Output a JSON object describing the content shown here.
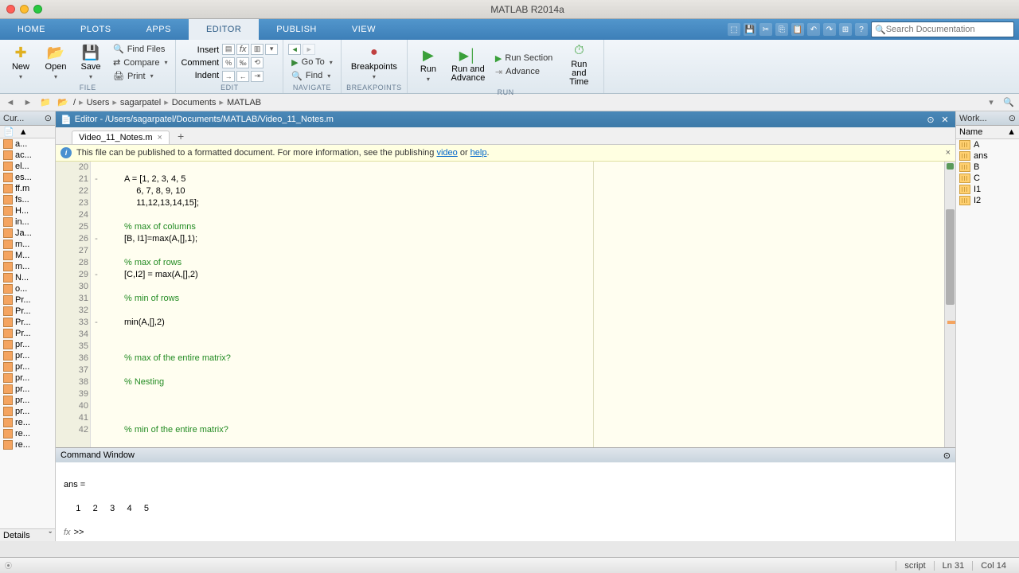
{
  "title": "MATLAB R2014a",
  "tabs": [
    "HOME",
    "PLOTS",
    "APPS",
    "EDITOR",
    "PUBLISH",
    "VIEW"
  ],
  "activeTab": "EDITOR",
  "search_placeholder": "Search Documentation",
  "toolstrip": {
    "file": {
      "new": "New",
      "open": "Open",
      "save": "Save",
      "find_files": "Find Files",
      "compare": "Compare",
      "print": "Print",
      "label": "FILE"
    },
    "edit": {
      "insert": "Insert",
      "comment": "Comment",
      "indent": "Indent",
      "label": "EDIT"
    },
    "navigate": {
      "goto": "Go To",
      "find": "Find",
      "label": "NAVIGATE"
    },
    "breakpoints": {
      "breakpoints": "Breakpoints",
      "label": "BREAKPOINTS"
    },
    "run": {
      "run": "Run",
      "run_advance": "Run and Advance",
      "run_section": "Run Section",
      "advance": "Advance",
      "run_time": "Run and Time",
      "label": "RUN"
    }
  },
  "addrbar": [
    "Users",
    "sagarpatel",
    "Documents",
    "MATLAB"
  ],
  "sidebar_left": {
    "title": "Cur...",
    "files": [
      "a...",
      "ac...",
      "el...",
      "es...",
      "ff.m",
      "fs...",
      "H...",
      "in...",
      "Ja...",
      "m...",
      "M...",
      "m...",
      "N...",
      "o...",
      "Pr...",
      "Pr...",
      "Pr...",
      "Pr...",
      "pr...",
      "pr...",
      "pr...",
      "pr...",
      "pr...",
      "pr...",
      "pr...",
      "re...",
      "re...",
      "re..."
    ],
    "details": "Details"
  },
  "editor": {
    "title": "Editor - /Users/sagarpatel/Documents/MATLAB/Video_11_Notes.m",
    "tab_name": "Video_11_Notes.m",
    "banner_text": "This file can be published to a formatted document. For more information, see the publishing ",
    "banner_link1": "video",
    "banner_or": " or ",
    "banner_link2": "help",
    "banner_period": ".",
    "lines": [
      {
        "num": 20,
        "exec": "",
        "text": ""
      },
      {
        "num": 21,
        "exec": "-",
        "text": "A = [1, 2, 3, 4, 5"
      },
      {
        "num": 22,
        "exec": "",
        "text": "     6, 7, 8, 9, 10"
      },
      {
        "num": 23,
        "exec": "",
        "text": "     11,12,13,14,15];"
      },
      {
        "num": 24,
        "exec": "",
        "text": ""
      },
      {
        "num": 25,
        "exec": "",
        "text": "% max of columns",
        "comment": true
      },
      {
        "num": 26,
        "exec": "-",
        "text": "[B, I1]=max(A,[],1);"
      },
      {
        "num": 27,
        "exec": "",
        "text": ""
      },
      {
        "num": 28,
        "exec": "",
        "text": "% max of rows",
        "comment": true
      },
      {
        "num": 29,
        "exec": "-",
        "text": "[C,I2] = max(A,[],2)"
      },
      {
        "num": 30,
        "exec": "",
        "text": ""
      },
      {
        "num": 31,
        "exec": "",
        "text": "% min of rows",
        "comment": true
      },
      {
        "num": 32,
        "exec": "",
        "text": ""
      },
      {
        "num": 33,
        "exec": "-",
        "text": "min(A,[],2)"
      },
      {
        "num": 34,
        "exec": "",
        "text": ""
      },
      {
        "num": 35,
        "exec": "",
        "text": ""
      },
      {
        "num": 36,
        "exec": "",
        "text": "% max of the entire matrix?",
        "comment": true
      },
      {
        "num": 37,
        "exec": "",
        "text": ""
      },
      {
        "num": 38,
        "exec": "",
        "text": "% Nesting",
        "comment": true
      },
      {
        "num": 39,
        "exec": "",
        "text": ""
      },
      {
        "num": 40,
        "exec": "",
        "text": ""
      },
      {
        "num": 41,
        "exec": "",
        "text": ""
      },
      {
        "num": 42,
        "exec": "",
        "text": "% min of the entire matrix?",
        "comment": true
      }
    ]
  },
  "command_window": {
    "title": "Command Window",
    "output": [
      "",
      "ans =",
      "",
      "     1     2     3     4     5",
      ""
    ],
    "prompt": ">>"
  },
  "workspace": {
    "title": "Work...",
    "col": "Name",
    "vars": [
      "A",
      "ans",
      "B",
      "C",
      "I1",
      "I2"
    ]
  },
  "statusbar": {
    "type": "script",
    "ln": "Ln  31",
    "col": "Col  14"
  }
}
